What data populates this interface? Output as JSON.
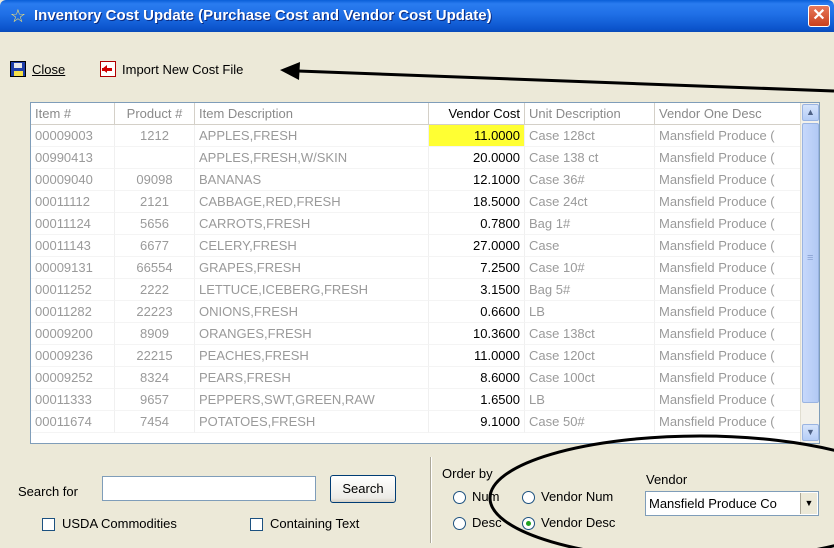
{
  "window": {
    "title": "Inventory Cost Update (Purchase Cost and Vendor Cost Update)",
    "close_glyph": "✕"
  },
  "toolbar": {
    "close_label": "Close",
    "import_label": "Import New Cost File"
  },
  "grid": {
    "columns": [
      "Item #",
      "Product #",
      "Item Description",
      "Vendor Cost",
      "Unit Description",
      "Vendor One Desc"
    ],
    "rows": [
      {
        "item": "00009003",
        "product": "1212",
        "desc": "APPLES,FRESH",
        "cost": "11.0000",
        "unit": "Case 128ct",
        "vendor": "Mansfield Produce (",
        "highlight": true
      },
      {
        "item": "00990413",
        "product": "",
        "desc": "APPLES,FRESH,W/SKIN",
        "cost": "20.0000",
        "unit": "Case 138 ct",
        "vendor": "Mansfield Produce ("
      },
      {
        "item": "00009040",
        "product": "09098",
        "desc": "BANANAS",
        "cost": "12.1000",
        "unit": "Case 36#",
        "vendor": "Mansfield Produce ("
      },
      {
        "item": "00011112",
        "product": "2121",
        "desc": "CABBAGE,RED,FRESH",
        "cost": "18.5000",
        "unit": "Case 24ct",
        "vendor": "Mansfield Produce ("
      },
      {
        "item": "00011124",
        "product": "5656",
        "desc": "CARROTS,FRESH",
        "cost": "0.7800",
        "unit": "Bag 1#",
        "vendor": "Mansfield Produce ("
      },
      {
        "item": "00011143",
        "product": "6677",
        "desc": "CELERY,FRESH",
        "cost": "27.0000",
        "unit": "Case",
        "vendor": "Mansfield Produce ("
      },
      {
        "item": "00009131",
        "product": "66554",
        "desc": "GRAPES,FRESH",
        "cost": "7.2500",
        "unit": "Case 10#",
        "vendor": "Mansfield Produce ("
      },
      {
        "item": "00011252",
        "product": "2222",
        "desc": "LETTUCE,ICEBERG,FRESH",
        "cost": "3.1500",
        "unit": "Bag 5#",
        "vendor": "Mansfield Produce ("
      },
      {
        "item": "00011282",
        "product": "22223",
        "desc": "ONIONS,FRESH",
        "cost": "0.6600",
        "unit": "LB",
        "vendor": "Mansfield Produce ("
      },
      {
        "item": "00009200",
        "product": "8909",
        "desc": "ORANGES,FRESH",
        "cost": "10.3600",
        "unit": "Case 138ct",
        "vendor": "Mansfield Produce ("
      },
      {
        "item": "00009236",
        "product": "22215",
        "desc": "PEACHES,FRESH",
        "cost": "11.0000",
        "unit": "Case 120ct",
        "vendor": "Mansfield Produce ("
      },
      {
        "item": "00009252",
        "product": "8324",
        "desc": "PEARS,FRESH",
        "cost": "8.6000",
        "unit": "Case 100ct",
        "vendor": "Mansfield Produce ("
      },
      {
        "item": "00011333",
        "product": "9657",
        "desc": "PEPPERS,SWT,GREEN,RAW",
        "cost": "1.6500",
        "unit": "LB",
        "vendor": "Mansfield Produce ("
      },
      {
        "item": "00011674",
        "product": "7454",
        "desc": "POTATOES,FRESH",
        "cost": "9.1000",
        "unit": "Case 50#",
        "vendor": "Mansfield Produce ("
      }
    ]
  },
  "search": {
    "label": "Search for",
    "value": "",
    "button_label": "Search",
    "usda_label": "USDA Commodities",
    "containing_label": "Containing Text"
  },
  "order_by": {
    "label": "Order by",
    "num_label": "Num",
    "desc_label": "Desc",
    "vendor_num_label": "Vendor Num",
    "vendor_desc_label": "Vendor Desc",
    "selected": "Vendor Desc"
  },
  "vendor": {
    "label": "Vendor",
    "selected": "Mansfield Produce Co"
  },
  "colors": {
    "highlight": "#ffff33",
    "titlebar": "#0b54cc",
    "annotation": "#000000"
  }
}
